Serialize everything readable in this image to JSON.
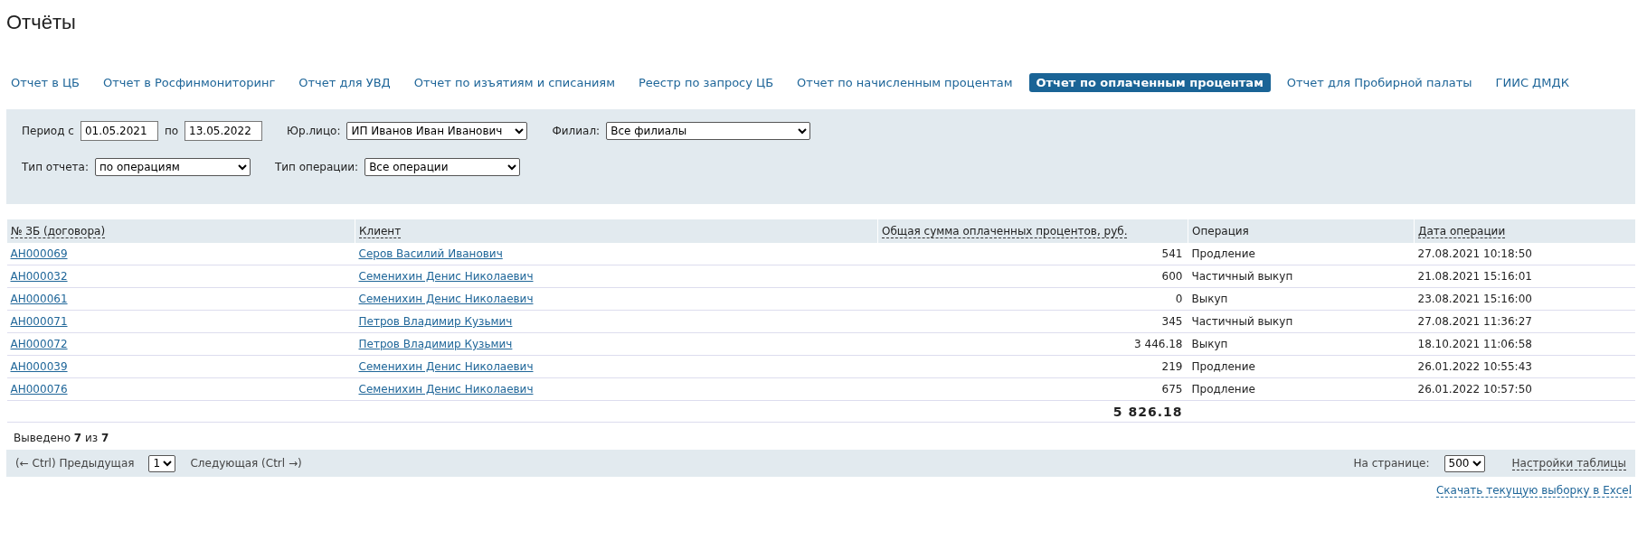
{
  "page_title": "Отчёты",
  "tabs": [
    {
      "label": "Отчет в ЦБ",
      "selected": false
    },
    {
      "label": "Отчет в Росфинмониторинг",
      "selected": false
    },
    {
      "label": "Отчет для УВД",
      "selected": false
    },
    {
      "label": "Отчет по изъятиям и списаниям",
      "selected": false
    },
    {
      "label": "Реестр по запросу ЦБ",
      "selected": false
    },
    {
      "label": "Отчет по начисленным процентам",
      "selected": false
    },
    {
      "label": "Отчет по оплаченным процентам",
      "selected": true
    },
    {
      "label": "Отчет для Пробирной палаты",
      "selected": false
    },
    {
      "label": "ГИИС ДМДК",
      "selected": false
    }
  ],
  "filters": {
    "period_label": "Период с",
    "period_from": "01.05.2021",
    "period_to_label": "по",
    "period_to": "13.05.2022",
    "entity_label": "Юр.лицо:",
    "entity": "ИП Иванов Иван Иванович",
    "branch_label": "Филиал:",
    "branch": "Все филиалы",
    "report_type_label": "Тип отчета:",
    "report_type": "по операциям",
    "operation_type_label": "Тип операции:",
    "operation_type": "Все операции"
  },
  "table": {
    "columns": [
      {
        "label": "№ ЗБ (договора)",
        "sortable": true
      },
      {
        "label": "Клиент",
        "sortable": true
      },
      {
        "label": "Общая сумма оплаченных процентов, руб.",
        "sortable": true
      },
      {
        "label": "Операция",
        "sortable": false
      },
      {
        "label": "Дата операции",
        "sortable": true
      }
    ],
    "rows": [
      [
        "АН000069",
        "Серов Василий Иванович",
        "541",
        "Продление",
        "27.08.2021 10:18:50"
      ],
      [
        "АН000032",
        "Семенихин Денис Николаевич",
        "600",
        "Частичный выкуп",
        "21.08.2021 15:16:01"
      ],
      [
        "АН000061",
        "Семенихин Денис Николаевич",
        "0",
        "Выкуп",
        "23.08.2021 15:16:00"
      ],
      [
        "АН000071",
        "Петров Владимир Кузьмич",
        "345",
        "Частичный выкуп",
        "27.08.2021 11:36:27"
      ],
      [
        "АН000072",
        "Петров Владимир Кузьмич",
        "3 446.18",
        "Выкуп",
        "18.10.2021 11:06:58"
      ],
      [
        "АН000039",
        "Семенихин Денис Николаевич",
        "219",
        "Продление",
        "26.01.2022 10:55:43"
      ],
      [
        "АН000076",
        "Семенихин Денис Николаевич",
        "675",
        "Продление",
        "26.01.2022 10:57:50"
      ]
    ],
    "total": "5 826.18"
  },
  "shown_count": "Выведено **7** из **7**",
  "pager": {
    "prev": "(← Ctrl) Предыдущая",
    "page": "1",
    "next": "Следующая (Ctrl →)",
    "per_page_label": "На странице:",
    "per_page": "500",
    "settings_link": "Настройки таблицы"
  },
  "excel_link": "Скачать текущую выборку в Excel"
}
